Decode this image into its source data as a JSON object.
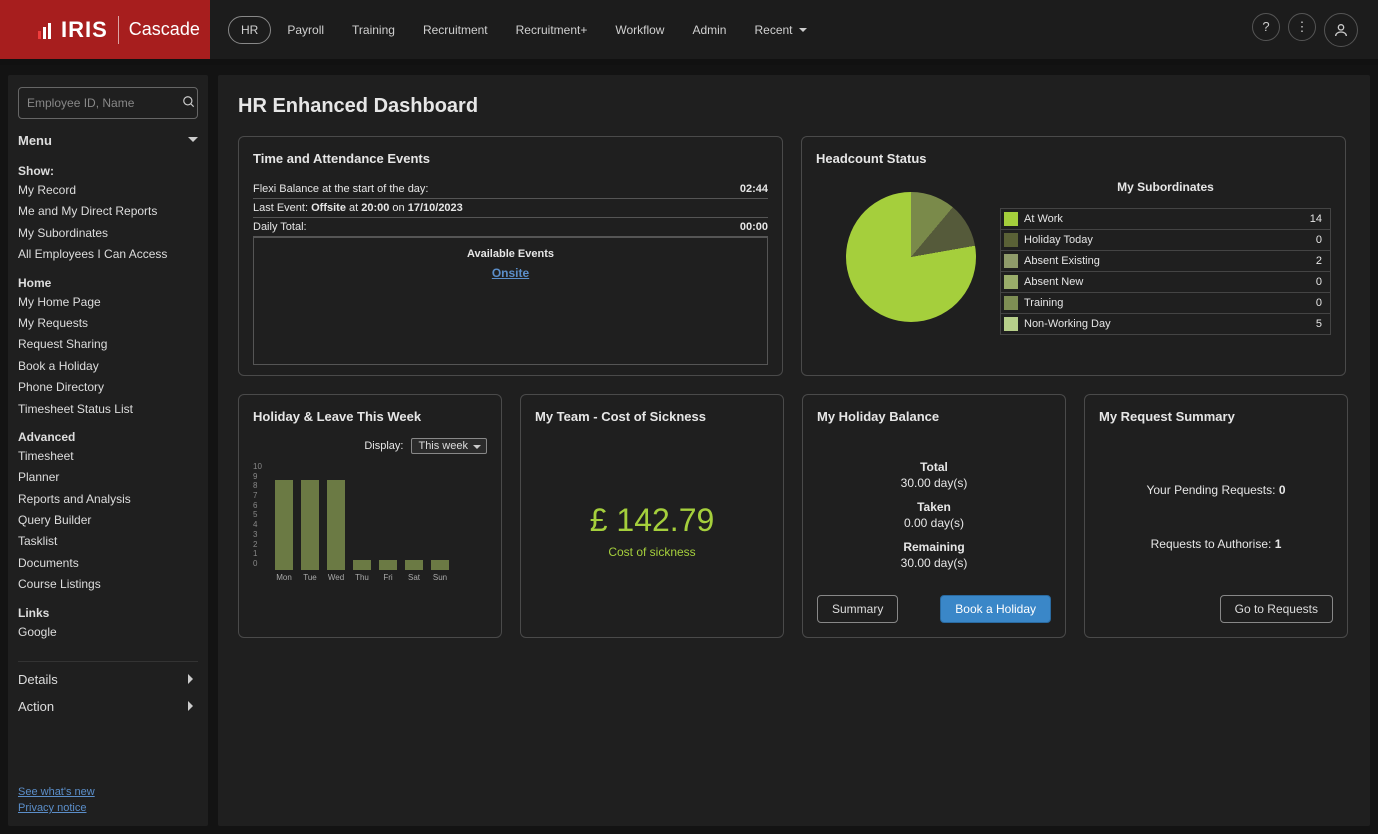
{
  "brand": {
    "iris": "IRIS",
    "cascade": "Cascade"
  },
  "nav": {
    "items": [
      "HR",
      "Payroll",
      "Training",
      "Recruitment",
      "Recruitment+",
      "Workflow",
      "Admin",
      "Recent"
    ],
    "active": 0
  },
  "search": {
    "placeholder": "Employee ID, Name"
  },
  "sidebar": {
    "menu": "Menu",
    "show_head": "Show:",
    "show": [
      "My Record",
      "Me and My Direct Reports",
      "My Subordinates",
      "All Employees I Can Access"
    ],
    "home_head": "Home",
    "home": [
      "My Home Page",
      "My Requests",
      "Request Sharing",
      "Book a Holiday",
      "Phone Directory",
      "Timesheet Status List"
    ],
    "adv_head": "Advanced",
    "adv": [
      "Timesheet",
      "Planner",
      "Reports and Analysis",
      "Query Builder",
      "Tasklist",
      "Documents",
      "Course Listings"
    ],
    "links_head": "Links",
    "links": [
      "Google"
    ],
    "details": "Details",
    "action": "Action",
    "whatsnew": "See what's new",
    "privacy": "Privacy notice"
  },
  "page": {
    "title": "HR Enhanced Dashboard"
  },
  "ta": {
    "title": "Time and Attendance Events",
    "flexi_label": "Flexi Balance at the start of the day:",
    "flexi_val": "02:44",
    "last_prefix": "Last Event: ",
    "last_evt": "Offsite",
    "last_at": " at ",
    "last_time": "20:00",
    "last_on": " on ",
    "last_date": "17/10/2023",
    "daily_label": "Daily Total:",
    "daily_val": "00:00",
    "avail_head": "Available Events",
    "avail_link": "Onsite"
  },
  "hc": {
    "title": "Headcount Status",
    "sub_title": "My Subordinates",
    "rows": [
      {
        "label": "At Work",
        "val": "14",
        "color": "#a5cf3c"
      },
      {
        "label": "Holiday Today",
        "val": "0",
        "color": "#5a6136"
      },
      {
        "label": "Absent Existing",
        "val": "2",
        "color": "#8f9b6a"
      },
      {
        "label": "Absent New",
        "val": "0",
        "color": "#9aad6a"
      },
      {
        "label": "Training",
        "val": "0",
        "color": "#7e8e54"
      },
      {
        "label": "Non-Working Day",
        "val": "5",
        "color": "#b7cf8a"
      }
    ]
  },
  "hol": {
    "title": "Holiday & Leave This Week",
    "display": "Display:",
    "select": "This week"
  },
  "sick": {
    "title": "My Team - Cost of Sickness",
    "amount": "£ 142.79",
    "sub": "Cost of sickness"
  },
  "bal": {
    "title": "My Holiday Balance",
    "total_l": "Total",
    "total_v": "30.00 day(s)",
    "taken_l": "Taken",
    "taken_v": "0.00 day(s)",
    "rem_l": "Remaining",
    "rem_v": "30.00 day(s)",
    "btn_summary": "Summary",
    "btn_book": "Book a Holiday"
  },
  "req": {
    "title": "My Request Summary",
    "pending_l": "Your Pending Requests: ",
    "pending_v": "0",
    "auth_l": "Requests to Authorise: ",
    "auth_v": "1",
    "btn": "Go to Requests"
  },
  "chart_data": {
    "type": "bar",
    "categories": [
      "Mon",
      "Tue",
      "Wed",
      "Thu",
      "Fri",
      "Sat",
      "Sun"
    ],
    "values": [
      9,
      9,
      9,
      1,
      1,
      1,
      1
    ],
    "ylim": [
      0,
      10
    ],
    "yticks": [
      10,
      9,
      8,
      7,
      6,
      5,
      4,
      3,
      2,
      1,
      0
    ],
    "title": "Holiday & Leave This Week",
    "xlabel": "",
    "ylabel": ""
  }
}
